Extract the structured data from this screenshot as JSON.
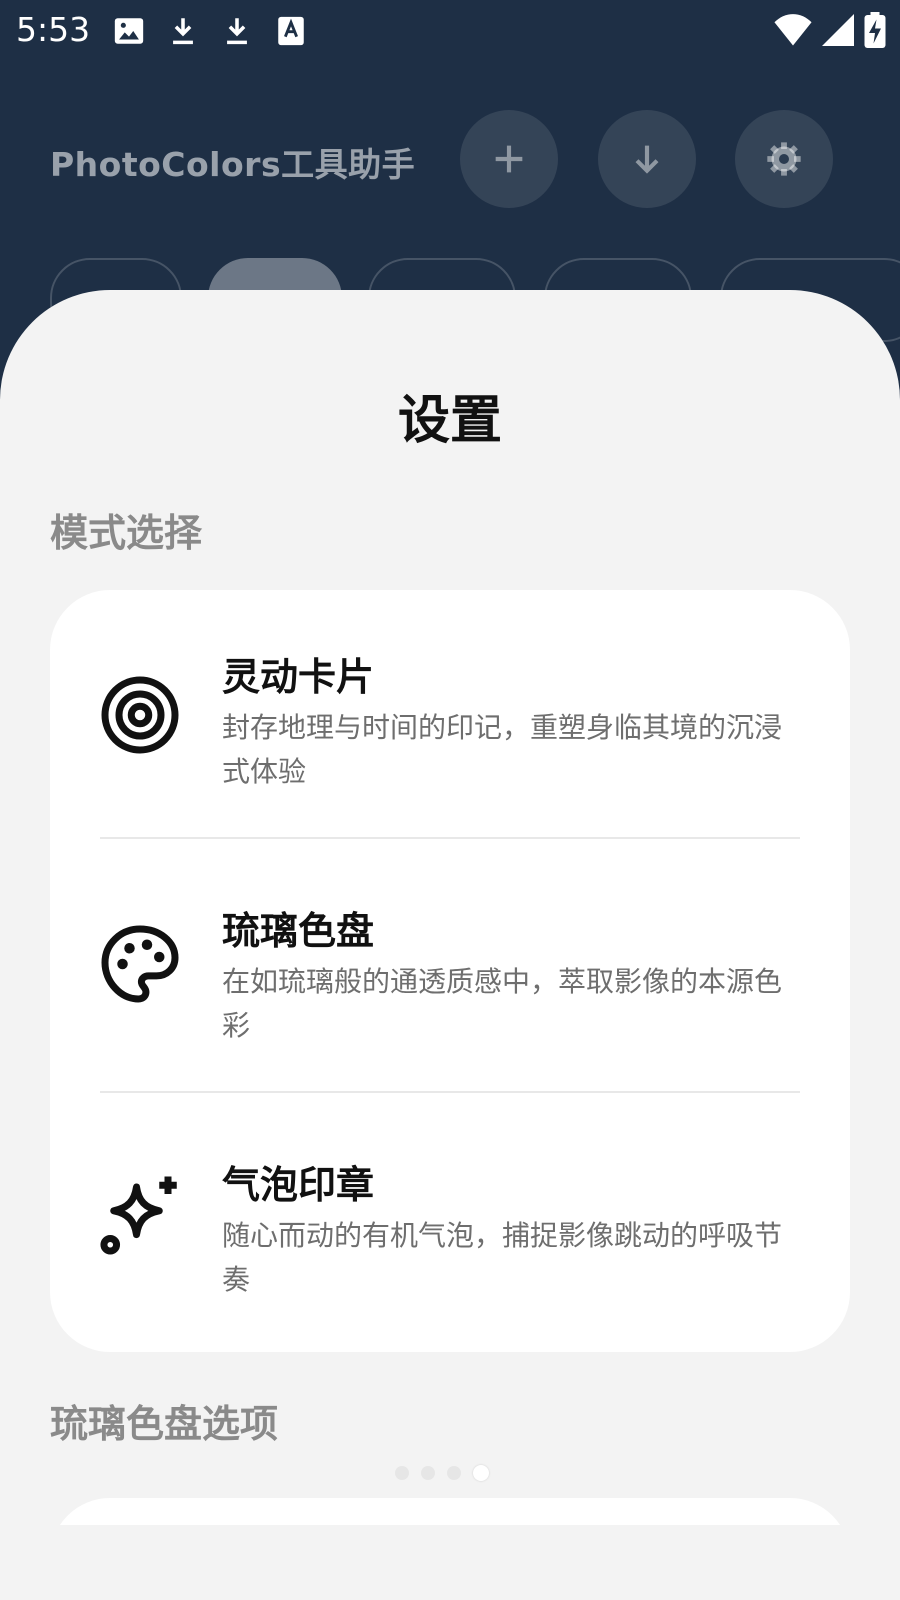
{
  "status_bar": {
    "time": "5:53",
    "icons": [
      "image-icon",
      "download-icon",
      "download-icon",
      "text-recognition-icon",
      "wifi-icon",
      "signal-icon",
      "battery-charging-icon"
    ]
  },
  "header": {
    "title": "PhotoColors工具助手",
    "buttons": [
      "add-icon",
      "download-icon",
      "settings-icon"
    ]
  },
  "sheet": {
    "title": "设置",
    "mode_section_label": "模式选择",
    "modes": [
      {
        "title": "灵动卡片",
        "desc": "封存地理与时间的印记，重塑身临其境的沉浸式体验",
        "icon": "target-icon"
      },
      {
        "title": "琉璃色盘",
        "desc": "在如琉璃般的通透质感中，萃取影像的本源色彩",
        "icon": "palette-icon"
      },
      {
        "title": "气泡印章",
        "desc": "随心而动的有机气泡，捕捉影像跳动的呼吸节奏",
        "icon": "sparkles-icon"
      }
    ],
    "options_section_label": "琉璃色盘选项"
  },
  "colors": {
    "app_background": "#1e2f45",
    "sheet_background": "#f3f3f3",
    "card_background": "#ffffff"
  }
}
